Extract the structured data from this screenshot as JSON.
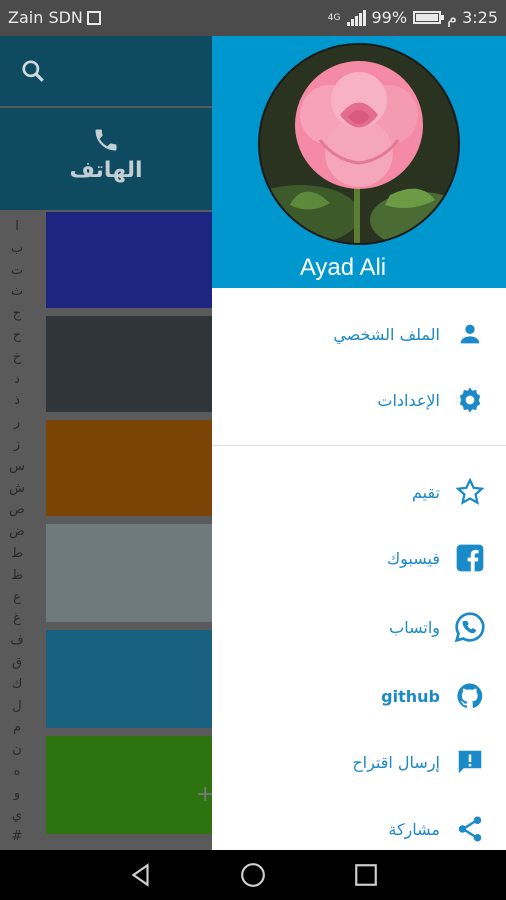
{
  "status_bar": {
    "carrier": "Zain SDN",
    "signal_label": "4G",
    "battery_percent": "99%",
    "battery_level": 0.99,
    "time": "3:25 م"
  },
  "background_app": {
    "tab_label": "الهاتف",
    "alphabet": [
      "ا",
      "ب",
      "ت",
      "ث",
      "ج",
      "ح",
      "خ",
      "د",
      "ذ",
      "ر",
      "ز",
      "س",
      "ش",
      "ص",
      "ض",
      "ط",
      "ظ",
      "ع",
      "غ",
      "ف",
      "ق",
      "ك",
      "ل",
      "م",
      "ن",
      "ه",
      "و",
      "ي",
      "#"
    ],
    "tile_colors": [
      "#1c2680",
      "#2f3538",
      "#7a4407",
      "#6e7a7b",
      "#17607e",
      "#2d7310"
    ]
  },
  "drawer": {
    "user_name": "Ayad Ali",
    "accent_color": "#0097cf",
    "menu_primary": [
      {
        "label": "الملف الشخصي",
        "icon": "person-icon"
      },
      {
        "label": "الإعدادات",
        "icon": "gear-icon"
      }
    ],
    "menu_secondary": [
      {
        "label": "تقيم",
        "icon": "star-icon"
      },
      {
        "label": "فيسبوك",
        "icon": "facebook-icon"
      },
      {
        "label": "واتساب",
        "icon": "whatsapp-icon"
      },
      {
        "label": "github",
        "icon": "github-icon"
      },
      {
        "label": "إرسال اقتراح",
        "icon": "feedback-icon"
      },
      {
        "label": "مشاركة",
        "icon": "share-icon"
      }
    ]
  },
  "nav_bar": {
    "buttons": [
      "back-icon",
      "home-icon",
      "recents-icon"
    ]
  }
}
